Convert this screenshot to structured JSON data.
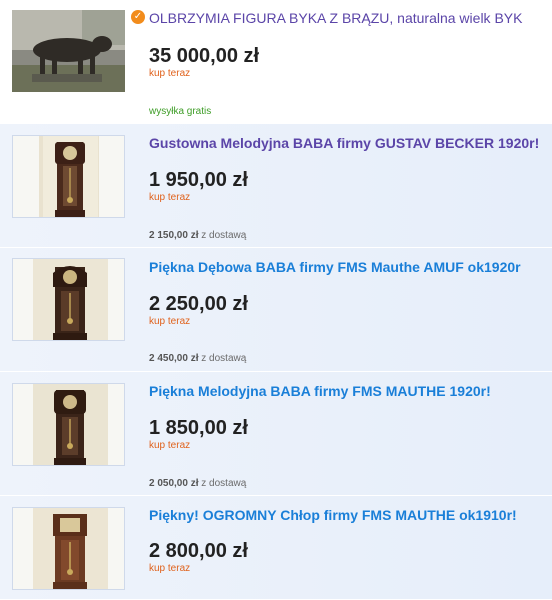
{
  "listings": [
    {
      "title": "OLBRZYMIA FIGURA BYKA Z BRĄZU, naturalna wielk BYK",
      "price": "35 000,00 zł",
      "buy_label": "kup teraz",
      "shipping": "wysyłka gratis",
      "badge_icon": "check-circle-icon",
      "thumb": "bronze-bull-statue"
    },
    {
      "title": "Gustowna Melodyjna BABA firmy GUSTAV BECKER 1920r!",
      "price": "1 950,00 zł",
      "buy_label": "kup teraz",
      "shipping_price": "2 150,00 zł",
      "shipping_suffix": "z dostawą",
      "thumb": "grandfather-clock"
    },
    {
      "title": "Piękna Dębowa BABA firmy FMS Mauthe AMUF ok1920r",
      "price": "2 250,00 zł",
      "buy_label": "kup teraz",
      "shipping_price": "2 450,00 zł",
      "shipping_suffix": "z dostawą",
      "thumb": "grandfather-clock"
    },
    {
      "title": "Piękna Melodyjna BABA firmy FMS MAUTHE 1920r!",
      "price": "1 850,00 zł",
      "buy_label": "kup teraz",
      "shipping_price": "2 050,00 zł",
      "shipping_suffix": "z dostawą",
      "thumb": "grandfather-clock"
    },
    {
      "title": "Piękny! OGROMNY Chłop firmy FMS MAUTHE ok1910r!",
      "price": "2 800,00 zł",
      "buy_label": "kup teraz",
      "thumb": "grandfather-clock"
    }
  ],
  "colors": {
    "title_visited": "#5b45a8",
    "title_link": "#1a7fd8",
    "buy_now": "#e0621c",
    "shipping_free": "#3e9d27",
    "row_alt_bg": "#eaf1fb",
    "badge": "#f28c1c"
  }
}
